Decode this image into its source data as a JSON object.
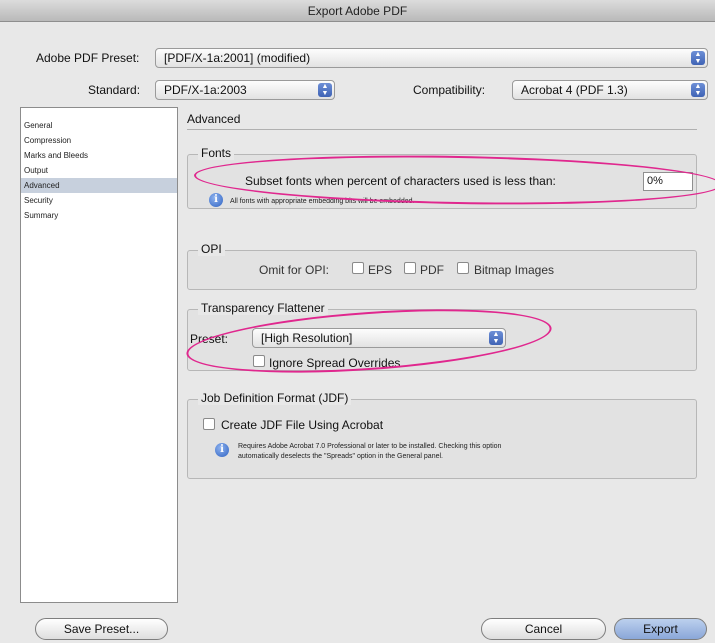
{
  "window": {
    "title": "Export Adobe PDF"
  },
  "preset": {
    "label": "Adobe PDF Preset:",
    "value": "[PDF/X-1a:2001] (modified)"
  },
  "standard": {
    "label": "Standard:",
    "value": "PDF/X-1a:2003"
  },
  "compatibility": {
    "label": "Compatibility:",
    "value": "Acrobat 4 (PDF 1.3)"
  },
  "sidebar": {
    "items": [
      {
        "label": "General"
      },
      {
        "label": "Compression"
      },
      {
        "label": "Marks and Bleeds"
      },
      {
        "label": "Output"
      },
      {
        "label": "Advanced"
      },
      {
        "label": "Security"
      },
      {
        "label": "Summary"
      }
    ],
    "selected": "Advanced"
  },
  "panel": {
    "title": "Advanced"
  },
  "fonts": {
    "title": "Fonts",
    "subset_label": "Subset fonts when percent of characters used is less than:",
    "subset_value": "0%",
    "note": "All fonts with appropriate embedding bits will be embedded."
  },
  "opi": {
    "title": "OPI",
    "omit_label": "Omit for OPI:",
    "options": [
      "EPS",
      "PDF",
      "Bitmap Images"
    ]
  },
  "flattener": {
    "title": "Transparency Flattener",
    "preset_label": "Preset:",
    "preset_value": "[High Resolution]",
    "ignore_label": "Ignore Spread Overrides"
  },
  "jdf": {
    "title": "Job Definition Format (JDF)",
    "create_label": "Create JDF File Using Acrobat",
    "note_line1": "Requires Adobe Acrobat 7.0 Professional or later to be installed. Checking this option",
    "note_line2": "automatically deselects the \"Spreads\" option in the General panel."
  },
  "buttons": {
    "save_preset": "Save Preset...",
    "cancel": "Cancel",
    "export": "Export"
  },
  "colors": {
    "annotation": "#e0278e",
    "selection": "#c7d0dd"
  }
}
